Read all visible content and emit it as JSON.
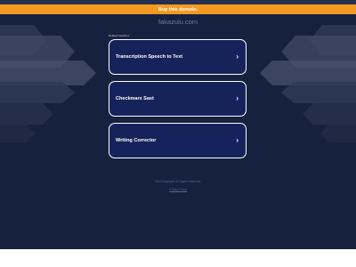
{
  "banner": {
    "label": "Buy this domain."
  },
  "site": {
    "domain": "fakazulu.com"
  },
  "related": {
    "heading": "Related searches",
    "items": [
      {
        "label": "Transcription Speech to Text"
      },
      {
        "label": "Checkmarx Sast"
      },
      {
        "label": "Writing Corrector"
      }
    ]
  },
  "footer": {
    "copyright": "2024 Copyright. All Rights Reserved.",
    "privacy": "Privacy Policy"
  },
  "colors": {
    "background": "#16213f",
    "banner": "#f39a22",
    "card": "#16235a",
    "card_border": "#ffffff"
  },
  "icons": {
    "card_arrow": "chevron-right-icon"
  }
}
